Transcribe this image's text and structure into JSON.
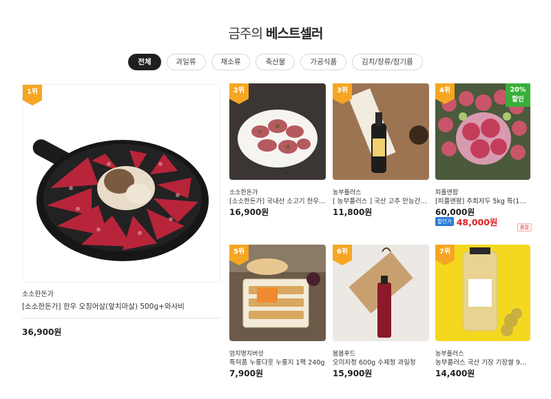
{
  "header": {
    "title_light": "금주의",
    "title_bold": "베스트셀러"
  },
  "tabs": [
    {
      "label": "전체",
      "active": true
    },
    {
      "label": "과일류",
      "active": false
    },
    {
      "label": "채소류",
      "active": false
    },
    {
      "label": "축산물",
      "active": false
    },
    {
      "label": "가공식품",
      "active": false
    },
    {
      "label": "김치/장류/참기름",
      "active": false
    }
  ],
  "products": [
    {
      "rank": "1위",
      "brand": "소소한돈가",
      "name": "[소소한돈가] 한우 오징어살(앞치마살) 500g+와사비",
      "price": "36,900원"
    },
    {
      "rank": "2위",
      "brand": "소소한돈가",
      "name": "[소소한돈가] 국내산 소고기 한우 1…",
      "price": "16,900원"
    },
    {
      "rank": "3위",
      "brand": "농부플러스",
      "name": "[ 농부플러스 ] 국산 고추 만능간장 …",
      "price": "11,800원"
    },
    {
      "rank": "4위",
      "brand": "피플앤팜",
      "name": "[피플앤팜] 추희자두 5kg 특(120~…",
      "price": "60,000원",
      "discount_badge": "20%\n할인",
      "sale_tag": "할인가",
      "sale_price": "48,000원",
      "extra_tag": "품절"
    },
    {
      "rank": "5위",
      "brand": "엄지명지버섯",
      "name": "특허품 누룽다웃 누룽지 1팩 240g",
      "price": "7,900원"
    },
    {
      "rank": "6위",
      "brand": "봄봄푸드",
      "name": "오미자청 600g 수제청 과일청",
      "price": "15,900원"
    },
    {
      "rank": "7위",
      "brand": "농부플러스",
      "name": "농부플러스 국산 기장 기장쌀 950g",
      "price": "14,400원"
    }
  ],
  "colors": {
    "rank_badge": "#f5a623",
    "discount_badge": "#3aae3a",
    "sale_price": "#e02020",
    "sale_tag": "#2a7bd6"
  }
}
